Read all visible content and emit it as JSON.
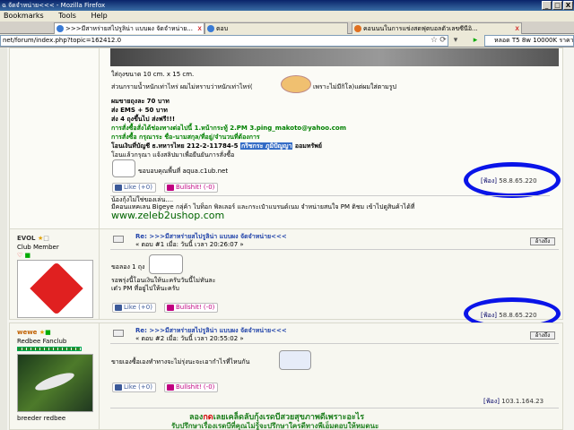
{
  "window": {
    "title": "ฉ จัดจำหน่าย<<< - Mozilla Firefox",
    "minimize": "_",
    "maximize": "□",
    "close": "X"
  },
  "menu": {
    "items": [
      "Bookmarks",
      "Tools",
      "Help"
    ]
  },
  "tabs": [
    {
      "label": ">>>มีสาหร่ายสไปรูลิน่า แบบผง จัดจำหน่าย...",
      "active": true
    },
    {
      "label": "ตอบ",
      "active": false
    },
    {
      "label": "คอนนนในการแข่งสดฟุตบอลตัวเลขซีนีอิ...",
      "active": false
    }
  ],
  "tab_close": "x",
  "url": "net/forum/index.php?topic=162412.0",
  "search": {
    "value": "หลอด T5 8w 10000K ราคา"
  },
  "nav": {
    "star": "☆",
    "reload": "⟳",
    "dropdown": "▾",
    "go": "▸"
  },
  "post1": {
    "lines": [
      "ใส่ถุงขนาด 10 cm. x 15 cm.",
      "ส่วนกรามน้ำหนักเท่าไหร่  ผมไม่ทราบว่าหนักเท่าไหร่(",
      "เพราะไม่มีกิโล)แต่ผมใส่ตามรูป",
      "ผมขายถุงละ 70 บาท",
      "ส่ง EMS + 50 บาท",
      "ส่ง 4 ถุงขึ้นไป ส่งฟรี!!!",
      "การสั่งซื้อสั่งได้ช่องทางต่อไปนี้      1.หน้ากระทู้     2.PM   ",
      "3.ping_makoto@yahoo.com",
      "การสั่งซื้อ กรุณาระ ชื่อ-นามสกุล/ที่อยู่/จำนวนที่ต้องการ",
      "โอนเงินที่บัญชี  ธ.ทหารไทย  212-2-11784-5  ",
      "กริชกระ ภูมิปัญญา",
      " ออมทรัพย์",
      "โอนแล้วกรุณา แจ้งสลิปมาเพื่อยืนยันการสั่งซื้อ",
      "ขอบอบคุณพื้นที่ aqua.c1ub.net"
    ],
    "like": "Like (+0)",
    "bullshit": "Bullshit! (-0)",
    "ip_tag": "[ฟ้อง]",
    "ip": "58.8.65.220",
    "sig_line1": "น้องกุ้งไม่ใช่ของเล่น....",
    "sig_line2": "มีคอนแทคเลน Bigeye กลุ่ค้า ไบท็อก พิลเลอร์ และกระเป๋าแบรนด์เนม จำหน่ายสนใจ PM ติชม เข้าไปดูสินค้าได้ที่",
    "sig_url": "www.zeleb2ushop.com"
  },
  "post2": {
    "user": "EVOL",
    "role": "Club Member",
    "title": "Re: >>>มีสาหร่ายสไปรูลิน่า แบบผง จัดจำหน่าย<<<",
    "meta": "« ตอบ #1 เมื่อ: วันนี้ เวลา 20:26:07 »",
    "quote_btn": "อ้างถึง",
    "line1": "ขอลอง 1 ถุง",
    "line2": "รอพรุ่งนี้โอนเงินให้นะครับวันนี้ไม่ทันละ",
    "line3": "เด๋ว PM ที่อยู่ไปให้นะครับ",
    "like": "Like (+0)",
    "bullshit": "Bullshit! (-0)",
    "ip_tag": "[ฟ้อง]",
    "ip": "58.8.65.220"
  },
  "post3": {
    "user": "wewe",
    "role": "Redbee Fanclub",
    "rank_caption": "breeder redbee",
    "title": "Re: >>>มีสาหร่ายสไปรูลิน่า แบบผง จัดจำหน่าย<<<",
    "meta": "« ตอบ #2 เมื่อ: วันนี้ เวลา 20:55:02 »",
    "quote_btn": "อ้างถึง",
    "line1": "ขายเองซื้อเองทำทางจะไม่รุ่งนะจะเอากำไรที่ไหนกัน",
    "like": "Like (+0)",
    "bullshit": "Bullshit! (-0)",
    "ip_tag": "[ฟ้อง]",
    "ip": "103.1.164.23",
    "footer1_a": "ลอง",
    "footer1_b": "กด",
    "footer1_c": "เลยเคล็ดลับกุ้งเรดบีสวยสุขภาพดีเพราะอะไร",
    "footer2": "รับปรึกษาเรื่องเรดบีที่คุณไม่รู้จะปรึกษาใครดีทางพีเอ็มตอบให้หมดนะ"
  }
}
